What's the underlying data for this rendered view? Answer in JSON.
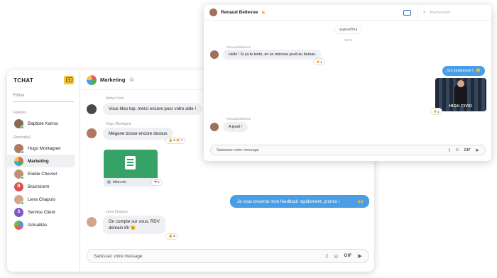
{
  "main_window": {
    "sidebar": {
      "title": "TCHAT",
      "new_chat_icon": "new-chat-icon",
      "filter_placeholder": "Filtrer",
      "favorites_label": "Favoris",
      "favorites": [
        {
          "name": "Baptiste Karros",
          "status": "online"
        }
      ],
      "recents_label": "Recent(s)",
      "recents": [
        {
          "name": "Hugo Montagner",
          "status": "online"
        },
        {
          "name": "Marketing",
          "status": "group",
          "active": true
        },
        {
          "name": "Elodie Chevrel",
          "status": "online"
        },
        {
          "name": "Brainstorm",
          "status": "group",
          "initial": "B"
        },
        {
          "name": "Lena Chapuis",
          "status": "online"
        },
        {
          "name": "Service Client",
          "status": "group",
          "initial": "S"
        },
        {
          "name": "Actualités",
          "status": "group"
        }
      ]
    },
    "conversation": {
      "title": "Marketing",
      "messages": [
        {
          "author": "Arthur Petit",
          "text": "Vous êtes top, merci encore pour votre aide !"
        },
        {
          "author": "Hugo Montagne",
          "text": "Mégane bosse encore dessus",
          "reactions": [
            {
              "emoji": "👍",
              "count": "4"
            },
            {
              "emoji": "👏",
              "count": "7"
            }
          ]
        },
        {
          "file_name": "bilan.xls",
          "reactions": [
            {
              "emoji": "❤",
              "count": "4"
            }
          ]
        },
        {
          "own": true,
          "text": "Je vous enverrai mon feedback rapidement, promis !",
          "emoji": "🙌"
        },
        {
          "author": "Lena Chapuis",
          "text_line1": "On compte sur vous, RDV",
          "text_line2": "demain 8h",
          "emoji": "😉",
          "reactions": [
            {
              "emoji": "👍",
              "count": "3"
            }
          ]
        }
      ],
      "composer_placeholder": "Saisissez votre message",
      "gif_label": "GIF"
    }
  },
  "front_window": {
    "title": "Renaud Bellevue",
    "search_placeholder": "Rechercher",
    "date_label": "aujourd'hui",
    "time_label": "10:01",
    "messages": [
      {
        "author": "Renaud Bellevue",
        "text": "Hello ! Si ça te tente, on se retrouve jeudi au bureau",
        "reactions": [
          {
            "emoji": "👍",
            "count": "1"
          }
        ]
      },
      {
        "own": true,
        "text": "Oui totalement !",
        "emoji": "😊"
      },
      {
        "own": true,
        "gif_caption": "HIGH FIVE!",
        "reactions": [
          {
            "emoji": "👍",
            "count": "1"
          }
        ]
      },
      {
        "author": "Renaud Bellevue",
        "text": "A jeudi !"
      }
    ],
    "composer_placeholder": "Saisissez votre message",
    "gif_label": "GIF"
  },
  "colors": {
    "accent_blue": "#4a9ee6",
    "online_green": "#34c759",
    "file_green": "#36a266",
    "star_gold": "#f4b400"
  }
}
